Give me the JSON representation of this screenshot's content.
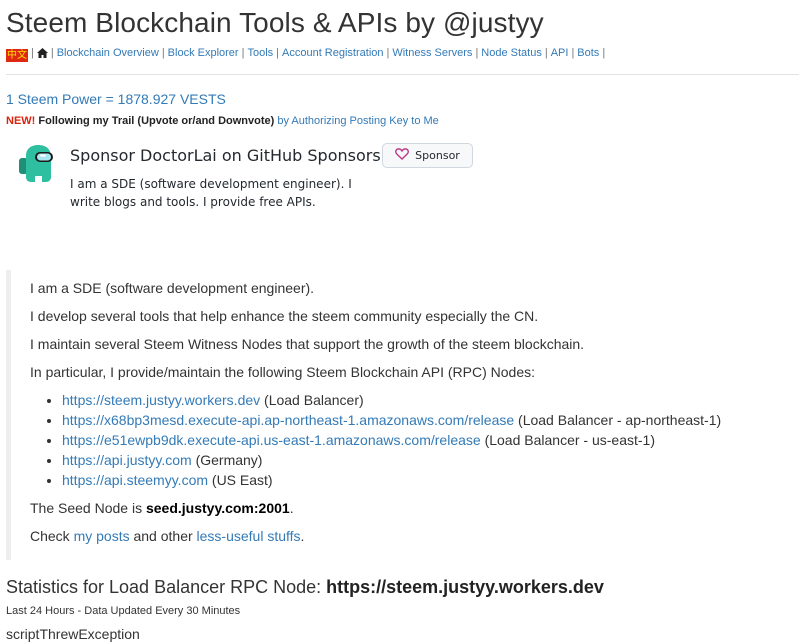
{
  "header": {
    "title": "Steem Blockchain Tools & APIs by @justyy"
  },
  "nav": {
    "flag_text": "中文",
    "links": [
      "Blockchain Overview",
      "Block Explorer",
      "Tools",
      "Account Registration",
      "Witness Servers",
      "Node Status",
      "API",
      "Bots"
    ]
  },
  "steem_power": "1 Steem Power = 1878.927 VESTS",
  "announcement": {
    "badge": "NEW!",
    "text": "Following my Trail (Upvote or/and Downvote)",
    "link": "by Authorizing Posting Key to Me"
  },
  "sponsor": {
    "title": "Sponsor DoctorLai on GitHub Sponsors",
    "description": "I am a SDE (software development engineer). I write blogs and tools. I provide free APIs.",
    "button_label": "Sponsor"
  },
  "about": {
    "p1": "I am a SDE (software development engineer).",
    "p2": "I develop several tools that help enhance the steem community especially the CN.",
    "p3": "I maintain several Steem Witness Nodes that support the growth of the steem blockchain.",
    "p4": "In particular, I provide/maintain the following Steem Blockchain API (RPC) Nodes:",
    "nodes": [
      {
        "url": "https://steem.justyy.workers.dev",
        "note": " (Load Balancer)"
      },
      {
        "url": "https://x68bp3mesd.execute-api.ap-northeast-1.amazonaws.com/release",
        "note": " (Load Balancer - ap-northeast-1)"
      },
      {
        "url": "https://e51ewpb9dk.execute-api.us-east-1.amazonaws.com/release",
        "note": " (Load Balancer - us-east-1)"
      },
      {
        "url": "https://api.justyy.com",
        "note": " (Germany)"
      },
      {
        "url": "https://api.steemyy.com",
        "note": " (US East)"
      }
    ],
    "seed_prefix": "The Seed Node is ",
    "seed_node": "seed.justyy.com:2001",
    "seed_suffix": ".",
    "check_prefix": "Check ",
    "my_posts": "my posts",
    "check_middle": " and other ",
    "less_useful": "less-useful stuffs",
    "check_suffix": "."
  },
  "stats": {
    "heading_prefix": "Statistics for Load Balancer RPC Node: ",
    "heading_node": "https://steem.justyy.workers.dev",
    "updated": "Last 24 Hours - Data Updated Every 30 Minutes",
    "error": "scriptThrewException"
  },
  "colors": {
    "link": "#337ab7",
    "new_badge": "#d9230f",
    "sponsor_heart": "#bf3989",
    "avatar": "#2ebfa0"
  }
}
